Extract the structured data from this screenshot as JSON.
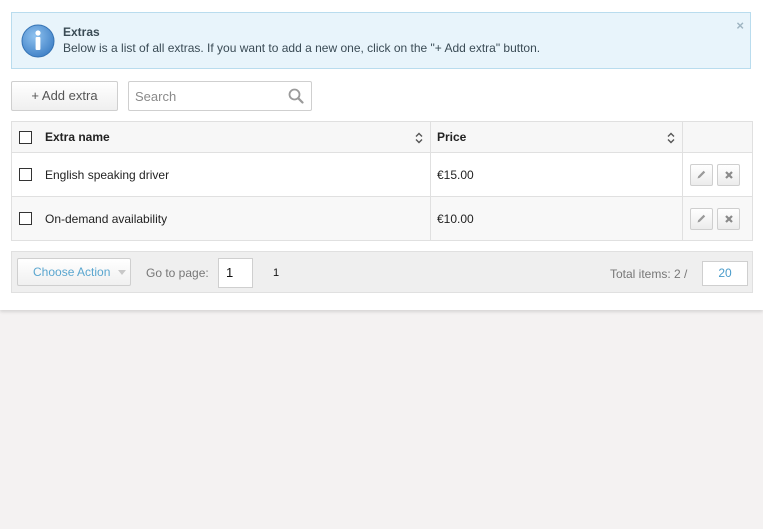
{
  "notice": {
    "title": "Extras",
    "message": "Below is a list of all extras. If you want to add a new one, click on the \"+ Add extra\" button.",
    "close_glyph": "×"
  },
  "toolbar": {
    "add_label": "+ Add extra",
    "search_placeholder": "Search"
  },
  "table": {
    "columns": {
      "name": "Extra name",
      "price": "Price"
    },
    "rows": [
      {
        "name": "English speaking driver",
        "price": "€15.00"
      },
      {
        "name": "On-demand availability",
        "price": "€10.00"
      }
    ]
  },
  "footer": {
    "choose_action": "Choose Action",
    "goto_label": "Go to page:",
    "page_value": "1",
    "page_link": "1",
    "total_label": "Total items: 2 /",
    "per_page": "20"
  },
  "colors": {
    "info_bg": "#e8f4fb",
    "info_border": "#b9dcee",
    "info_icon": "#4b8fd0",
    "link_blue": "#4a9ccb"
  },
  "icons": [
    "info-icon",
    "close-icon",
    "search-icon",
    "sort-icon",
    "pencil-icon",
    "delete-icon",
    "caret-down-icon"
  ]
}
